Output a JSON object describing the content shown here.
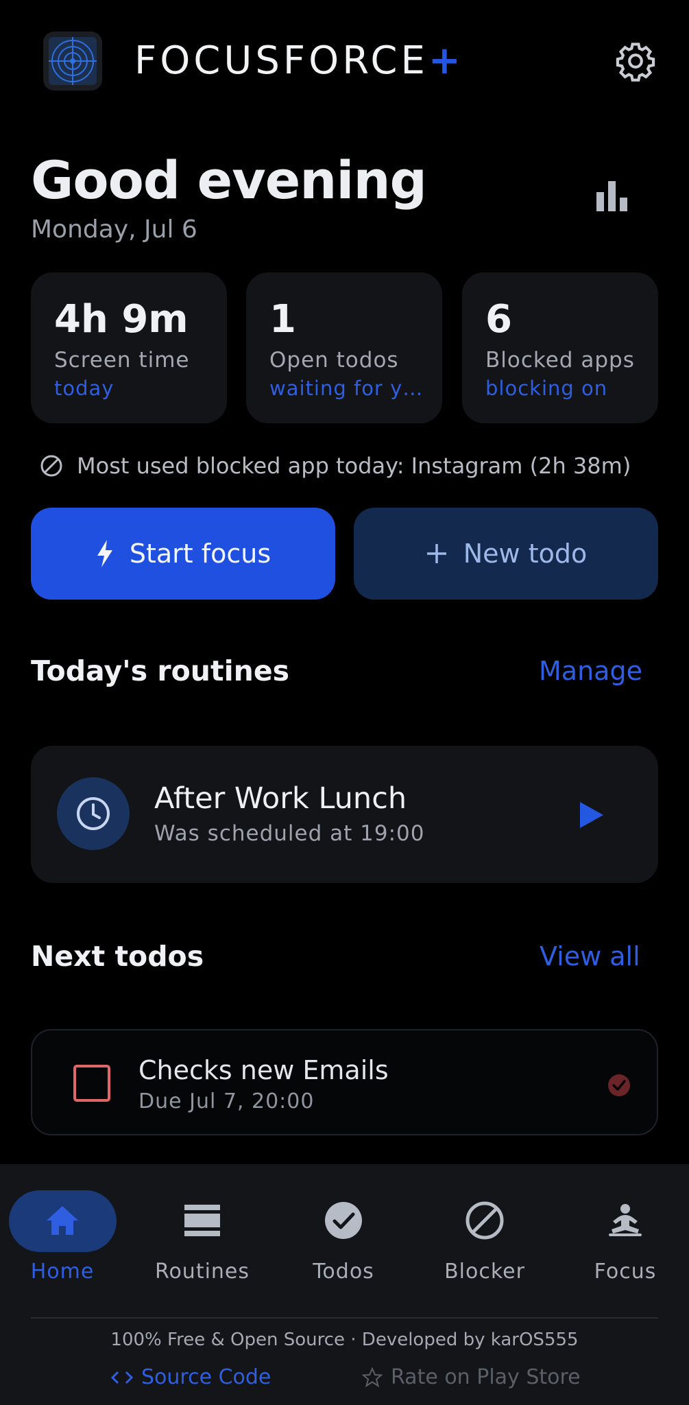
{
  "header": {
    "app_name": "FOCUSFORCE",
    "app_name_plus": "+",
    "settings_icon": "gear-icon"
  },
  "greeting": {
    "title": "Good evening",
    "date": "Monday, Jul 6",
    "stats_icon": "bar-chart-icon"
  },
  "stats": [
    {
      "value": "4h 9m",
      "label": "Screen time",
      "sub": "today"
    },
    {
      "value": "1",
      "label": "Open todos",
      "sub": "waiting for you"
    },
    {
      "value": "6",
      "label": "Blocked apps",
      "sub": "blocking on"
    }
  ],
  "blocked_note": "Most used blocked app today: Instagram (2h 38m)",
  "actions": {
    "start_focus": "Start focus",
    "new_todo": "New todo"
  },
  "routines": {
    "title": "Today's routines",
    "manage": "Manage",
    "items": [
      {
        "name": "After Work Lunch",
        "sub": "Was scheduled at 19:00"
      }
    ]
  },
  "todos": {
    "title": "Next todos",
    "view_all": "View all",
    "items": [
      {
        "name": "Checks new Emails",
        "due": "Due Jul 7, 20:00"
      }
    ]
  },
  "nav": {
    "items": [
      {
        "label": "Home",
        "icon": "home-icon",
        "active": true
      },
      {
        "label": "Routines",
        "icon": "routines-icon",
        "active": false
      },
      {
        "label": "Todos",
        "icon": "check-circle-icon",
        "active": false
      },
      {
        "label": "Blocker",
        "icon": "block-icon",
        "active": false
      },
      {
        "label": "Focus",
        "icon": "meditation-icon",
        "active": false
      }
    ]
  },
  "footer": {
    "text": "100% Free & Open Source · Developed by karOS555",
    "source_code": "Source Code",
    "rate": "Rate on Play Store"
  },
  "colors": {
    "accent": "#1f50e0",
    "background": "#000000",
    "card": "#121418",
    "todo_checkbox": "#e06767"
  }
}
